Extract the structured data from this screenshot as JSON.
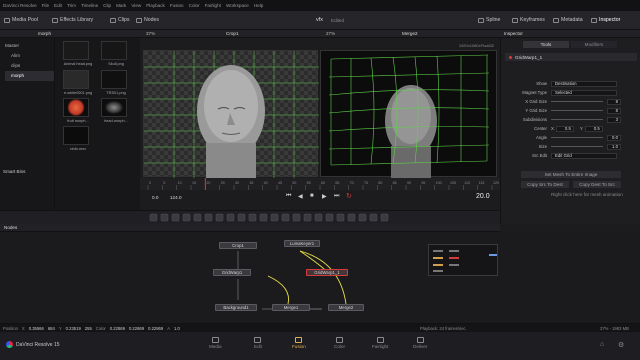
{
  "menu": [
    "DaVinci Resolve",
    "File",
    "Edit",
    "Trim",
    "Timeline",
    "Clip",
    "Mark",
    "View",
    "Playback",
    "Fusion",
    "Color",
    "Fairlight",
    "Workspace",
    "Help"
  ],
  "toolbar": {
    "media_pool": "Media Pool",
    "effects_library": "Effects Library",
    "clips": "Clips",
    "nodes": "Nodes",
    "project_title": "vfx",
    "edited": "Edited",
    "spline": "Spline",
    "keyframes": "Keyframes",
    "metadata": "Metadata",
    "inspector": "Inspector"
  },
  "media_pool": {
    "bin_name": "morph",
    "tree": [
      "Master",
      "Alim",
      "clips",
      "morph"
    ],
    "smart_bins": "Smart Bins",
    "clips": [
      {
        "name": "Animal head.png",
        "color": "#1a1a1a"
      },
      {
        "name": "Skull.png",
        "color": "#161616"
      },
      {
        "name": "e-white0001.png",
        "color": "#2a2a2a"
      },
      {
        "name": "TR3D1.png",
        "color": "#101010"
      },
      {
        "name": "fruit morph...",
        "color": "#d0502e"
      },
      {
        "name": "head-morph...",
        "color": "#1a1a1a"
      },
      {
        "name": "cinfo.mov",
        "color": "#0c0c0c"
      }
    ]
  },
  "viewers": {
    "left_zoom": "37%",
    "left_title": "Crop1",
    "right_zoom": "27%",
    "right_title": "Merge2",
    "resolution": "1920x1080xFloat32"
  },
  "timeline": {
    "ticks": [
      "0",
      "5",
      "10",
      "15",
      "20",
      "25",
      "30",
      "35",
      "40",
      "45",
      "50",
      "55",
      "60",
      "65",
      "70",
      "75",
      "80",
      "85",
      "90",
      "95",
      "100",
      "105",
      "110",
      "115",
      "120"
    ],
    "start": "0.0",
    "end": "124.0",
    "current": "20.0"
  },
  "inspector": {
    "title": "Inspector",
    "tabs": [
      "Tools",
      "Modifiers"
    ],
    "tool_name": "GridWarp1_1",
    "rows": [
      {
        "label": "Show",
        "value": "Destination",
        "kind": "select"
      },
      {
        "label": "Magnet Type",
        "value": "Selected",
        "kind": "select"
      },
      {
        "label": "X Grid Size",
        "value": "8",
        "kind": "number"
      },
      {
        "label": "Y Grid Size",
        "value": "8",
        "kind": "number"
      },
      {
        "label": "Subdivisions",
        "value": "3",
        "kind": "number"
      },
      {
        "label": "Center",
        "value": "0.5",
        "value2": "0.5",
        "kind": "pair"
      },
      {
        "label": "Angle",
        "value": "0.0",
        "kind": "number"
      },
      {
        "label": "Size",
        "value": "1.0",
        "kind": "number"
      },
      {
        "label": "Src Edit",
        "value": "Edit Grid",
        "kind": "select"
      }
    ],
    "btn_set_mesh": "Set Mesh To Entire Image",
    "btn_copy_src": "Copy Src To Dest",
    "btn_copy_dest": "Copy Dest To Src",
    "hint": "Right click here for mesh animation"
  },
  "nodes": {
    "panel_title": "Nodes",
    "items": {
      "crop": "Crop1",
      "lumakeyer": "LumaKeyer1",
      "gridwarp1": "GridWarp1",
      "gridwarp2": "GridWarp1_1",
      "background": "Background1",
      "merge1": "Merge1",
      "merge2": "Merge2"
    }
  },
  "statusbar": {
    "position_label": "Position",
    "x_label": "X",
    "x_val": "0.35566",
    "x_px": "684",
    "y_label": "Y",
    "y_val": "0.23519",
    "y_px": "255",
    "color_label": "Color",
    "r": "0.22869",
    "g": "0.22869",
    "b": "0.22869",
    "a_label": "A",
    "a_val": "1.0",
    "memory": "Playback: 24 frames/sec",
    "usage": "37% - 1983 MB"
  },
  "app_name": "DaVinci Resolve 15",
  "pages": [
    "Media",
    "Edit",
    "Fusion",
    "Color",
    "Fairlight",
    "Deliver"
  ],
  "active_page": "Fusion",
  "colors": {
    "accent": "#d43b3b",
    "grid": "#5fd14a",
    "active_page": "#e0b04a"
  }
}
